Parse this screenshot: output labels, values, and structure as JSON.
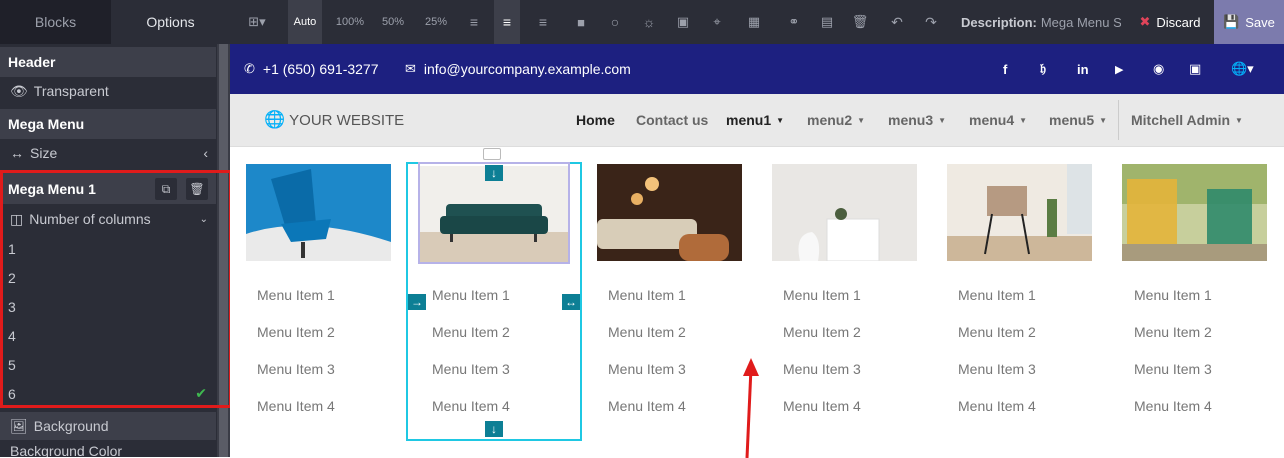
{
  "panel": {
    "tabs": [
      "Blocks",
      "Options"
    ],
    "header_section": "Header",
    "transparent_label": "Transparent",
    "mega_menu_section": "Mega Menu",
    "size_label": "Size",
    "mega_menu_1": "Mega Menu 1",
    "columns_label": "Number of columns",
    "column_options": [
      "1",
      "2",
      "3",
      "4",
      "5",
      "6"
    ],
    "selected_column": "6",
    "background_label": "Background",
    "background_color_label": "Background Color"
  },
  "toolbar": {
    "width_options": [
      "Auto",
      "100%",
      "50%",
      "25%"
    ],
    "description_label": "Description:",
    "description_value": "Mega Menu Sty",
    "discard_label": "Discard",
    "save_label": "Save"
  },
  "website": {
    "phone": "+1 (650) 691-3277",
    "email": "info@yourcompany.example.com",
    "logo": "YOUR WEBSITE",
    "nav": [
      "Home",
      "Contact us",
      "menu1",
      "menu2",
      "menu3",
      "menu4",
      "menu5"
    ],
    "user": "Mitchell Admin",
    "menu_items": [
      "Menu Item 1",
      "Menu Item 2",
      "Menu Item 3",
      "Menu Item 4"
    ]
  },
  "colors": {
    "topbar": "#1d2080",
    "accent": "#7c7bad",
    "selection": "#1fc8e3",
    "highlight_box": "#e01b1b"
  }
}
